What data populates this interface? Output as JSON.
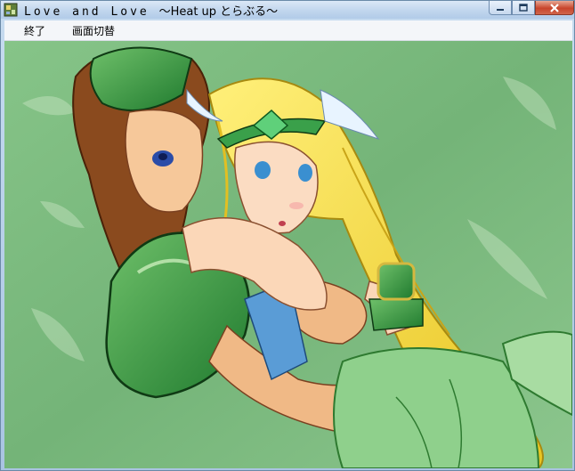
{
  "window": {
    "title_main": "Love and Love",
    "title_sub": "〜Heat up とらぶる〜"
  },
  "controls": {
    "minimize_icon": "minimize-icon",
    "maximize_icon": "maximize-icon",
    "close_icon": "close-icon"
  },
  "menu": {
    "items": [
      {
        "label": "終了"
      },
      {
        "label": "画面切替"
      }
    ]
  },
  "canvas": {
    "background_color": "#7dbb7f"
  }
}
